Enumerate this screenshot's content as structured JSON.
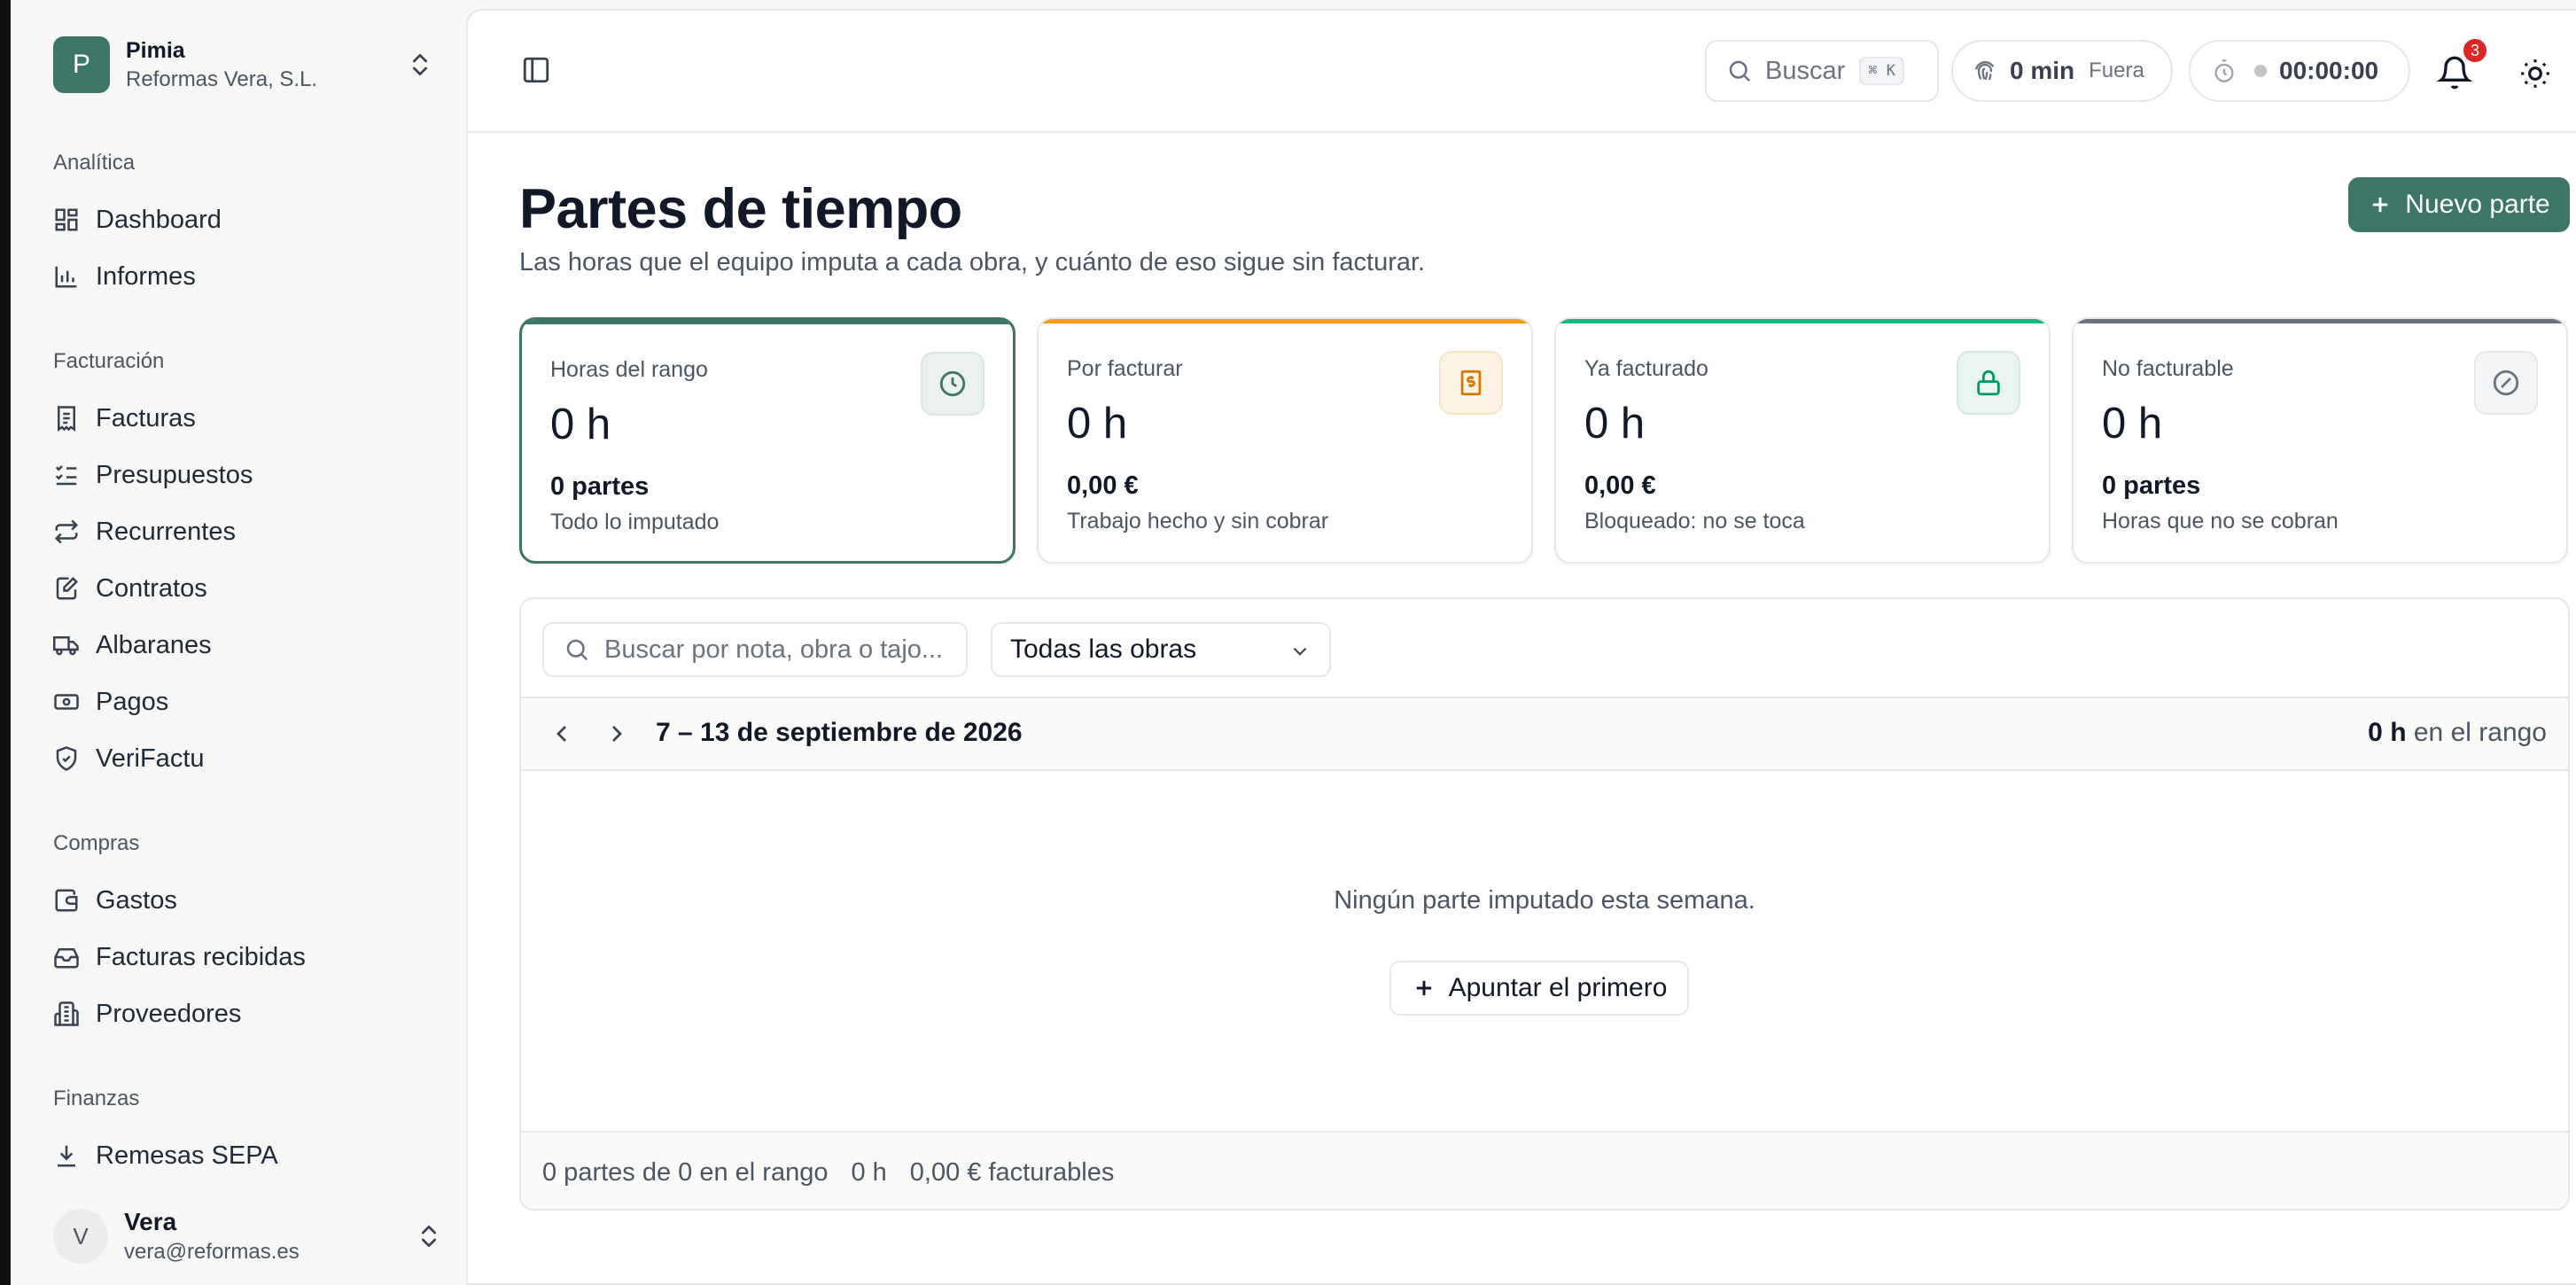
{
  "org": {
    "initial": "P",
    "name": "Pimia",
    "company": "Reformas Vera, S.L."
  },
  "sidebar": {
    "sections": [
      {
        "label": "Analítica",
        "items": [
          {
            "label": "Dashboard",
            "icon": "dashboard-icon"
          },
          {
            "label": "Informes",
            "icon": "bar-chart-icon"
          }
        ]
      },
      {
        "label": "Facturación",
        "items": [
          {
            "label": "Facturas",
            "icon": "invoice-icon"
          },
          {
            "label": "Presupuestos",
            "icon": "checklist-icon"
          },
          {
            "label": "Recurrentes",
            "icon": "repeat-icon"
          },
          {
            "label": "Contratos",
            "icon": "contract-icon"
          },
          {
            "label": "Albaranes",
            "icon": "truck-icon"
          },
          {
            "label": "Pagos",
            "icon": "banknote-icon"
          },
          {
            "label": "VeriFactu",
            "icon": "shield-check-icon"
          }
        ]
      },
      {
        "label": "Compras",
        "items": [
          {
            "label": "Gastos",
            "icon": "wallet-icon"
          },
          {
            "label": "Facturas recibidas",
            "icon": "inbox-icon"
          },
          {
            "label": "Proveedores",
            "icon": "building-icon"
          }
        ]
      },
      {
        "label": "Finanzas",
        "items": [
          {
            "label": "Remesas SEPA",
            "icon": "download-icon"
          }
        ]
      }
    ]
  },
  "user": {
    "initial": "V",
    "name": "Vera",
    "email": "vera@reformas.es"
  },
  "topbar": {
    "search_label": "Buscar",
    "search_shortcut": "⌘ K",
    "clock_value": "0 min",
    "clock_status": "Fuera",
    "timer_value": "00:00:00",
    "notifications_count": "3"
  },
  "page": {
    "title": "Partes de tiempo",
    "subtitle": "Las horas que el equipo imputa a cada obra, y cuánto de eso sigue sin facturar.",
    "new_button": "Nuevo parte"
  },
  "cards": [
    {
      "label": "Horas del rango",
      "value": "0 h",
      "foot": "0 partes",
      "note": "Todo lo imputado",
      "icon": "clock-icon",
      "accent": "#3d7566"
    },
    {
      "label": "Por facturar",
      "value": "0 h",
      "foot": "0,00 €",
      "note": "Trabajo hecho y sin cobrar",
      "icon": "receipt-icon",
      "accent": "#f59e0b"
    },
    {
      "label": "Ya facturado",
      "value": "0 h",
      "foot": "0,00 €",
      "note": "Bloqueado: no se toca",
      "icon": "lock-icon",
      "accent": "#10b981"
    },
    {
      "label": "No facturable",
      "value": "0 h",
      "foot": "0 partes",
      "note": "Horas que no se cobran",
      "icon": "ban-icon",
      "accent": "#6b7280"
    }
  ],
  "filters": {
    "search_placeholder": "Buscar por nota, obra o tajo...",
    "obra_selected": "Todas las obras"
  },
  "week": {
    "label": "7 – 13 de septiembre de 2026",
    "range_hours": "0 h",
    "range_suffix": "en el rango"
  },
  "empty": {
    "message": "Ningún parte imputado esta semana.",
    "button": "Apuntar el primero"
  },
  "footer": {
    "count": "0 partes de 0 en el rango",
    "hours": "0 h",
    "billable": "0,00 € facturables"
  }
}
